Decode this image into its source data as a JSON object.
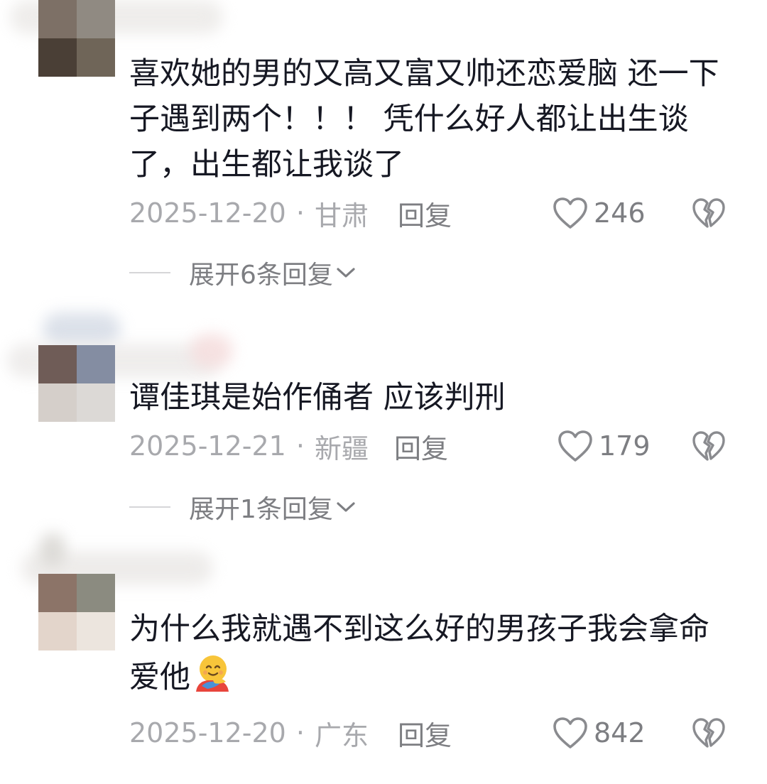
{
  "comments": [
    {
      "text": "喜欢她的男的又高又富又帅还恋爱脑 还一下子遇到两个！！！ 凭什么好人都让出生谈了，出生都让我谈了",
      "date": "2025-12-20",
      "location": "甘肃",
      "reply_label": "回复",
      "likes": "246",
      "expand_label": "展开6条回复",
      "avatar_colors": [
        "#7d7066",
        "#908a82",
        "#4a3f36",
        "#6f6558"
      ]
    },
    {
      "text": "谭佳琪是始作俑者 应该判刑",
      "date": "2025-12-21",
      "location": "新疆",
      "reply_label": "回复",
      "likes": "179",
      "expand_label": "展开1条回复",
      "avatar_colors": [
        "#6f5c57",
        "#848da2",
        "#d5cfca",
        "#dcd9d6"
      ]
    },
    {
      "text": "为什么我就遇不到这么好的男孩子我会拿命爱他",
      "emoji": "hugging-face-emoji",
      "date": "2025-12-20",
      "location": "广东",
      "reply_label": "回复",
      "likes": "842",
      "expand_label": "",
      "avatar_colors": [
        "#8c7468",
        "#8b8b80",
        "#e3d5cb",
        "#ece5de"
      ]
    }
  ],
  "separator": "·",
  "icons": {
    "like": "heart-outline-icon",
    "dislike": "broken-heart-icon",
    "expand": "chevron-down-icon"
  },
  "colors": {
    "text": "#161823",
    "meta": "#a8a9ad",
    "action": "#7d7e82"
  }
}
